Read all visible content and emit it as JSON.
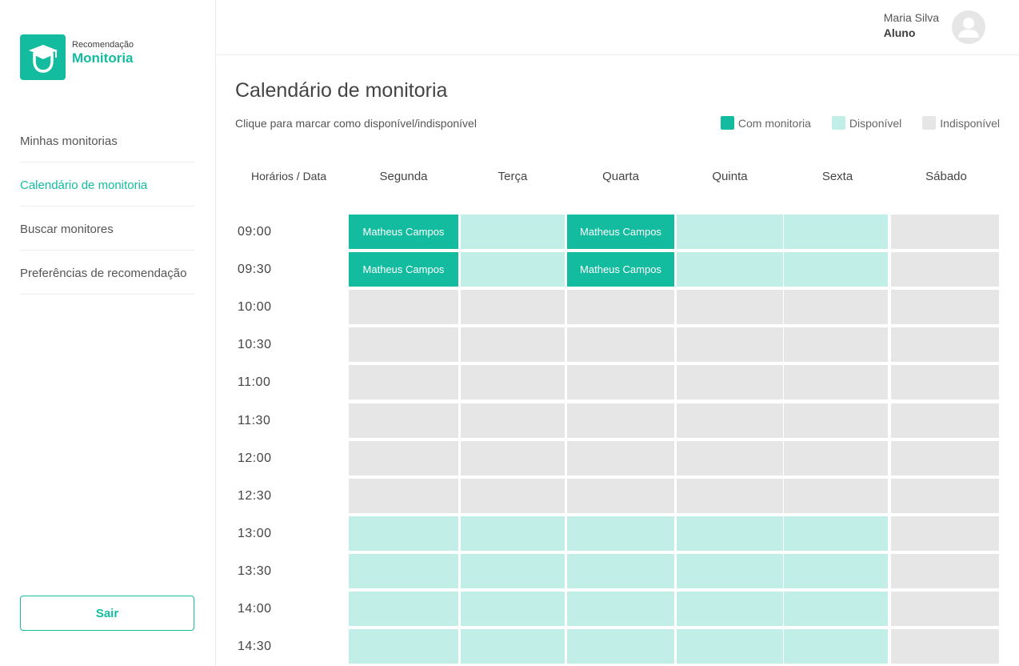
{
  "brand": {
    "subtitle": "Recomendação",
    "title": "Monitoria"
  },
  "nav": {
    "items": [
      {
        "label": "Minhas monitorias",
        "active": false
      },
      {
        "label": "Calendário de monitoria",
        "active": true
      },
      {
        "label": "Buscar monitores",
        "active": false
      },
      {
        "label": "Preferências de recomendação",
        "active": false
      }
    ],
    "logout_label": "Sair"
  },
  "user": {
    "name": "Maria Silva",
    "role": "Aluno",
    "avatar_icon": "user-avatar-icon"
  },
  "page": {
    "title": "Calendário de monitoria",
    "subtitle": "Clique para marcar como disponível/indisponível"
  },
  "legend": [
    {
      "label": "Com monitoria",
      "color": "#13bc9f"
    },
    {
      "label": "Disponível",
      "color": "#c2eee8"
    },
    {
      "label": "Indisponível",
      "color": "#e6e6e6"
    }
  ],
  "calendar": {
    "corner_header": "Horários / Data",
    "days": [
      "Segunda",
      "Terça",
      "Quarta",
      "Quinta",
      "Sexta",
      "Sábado"
    ],
    "rows": [
      {
        "time": "09:00",
        "cells": [
          {
            "status": "monitoria",
            "text": "Matheus Campos"
          },
          {
            "status": "disponivel",
            "text": ""
          },
          {
            "status": "monitoria",
            "text": "Matheus Campos"
          },
          {
            "status": "disponivel",
            "text": ""
          },
          {
            "status": "disponivel",
            "text": ""
          },
          {
            "status": "indisponivel",
            "text": ""
          }
        ]
      },
      {
        "time": "09:30",
        "cells": [
          {
            "status": "monitoria",
            "text": "Matheus Campos"
          },
          {
            "status": "disponivel",
            "text": ""
          },
          {
            "status": "monitoria",
            "text": "Matheus Campos"
          },
          {
            "status": "disponivel",
            "text": ""
          },
          {
            "status": "disponivel",
            "text": ""
          },
          {
            "status": "indisponivel",
            "text": ""
          }
        ]
      },
      {
        "time": "10:00",
        "cells": [
          {
            "status": "indisponivel",
            "text": ""
          },
          {
            "status": "indisponivel",
            "text": ""
          },
          {
            "status": "indisponivel",
            "text": ""
          },
          {
            "status": "indisponivel",
            "text": ""
          },
          {
            "status": "indisponivel",
            "text": ""
          },
          {
            "status": "indisponivel",
            "text": ""
          }
        ]
      },
      {
        "time": "10:30",
        "cells": [
          {
            "status": "indisponivel",
            "text": ""
          },
          {
            "status": "indisponivel",
            "text": ""
          },
          {
            "status": "indisponivel",
            "text": ""
          },
          {
            "status": "indisponivel",
            "text": ""
          },
          {
            "status": "indisponivel",
            "text": ""
          },
          {
            "status": "indisponivel",
            "text": ""
          }
        ]
      },
      {
        "time": "11:00",
        "cells": [
          {
            "status": "indisponivel",
            "text": ""
          },
          {
            "status": "indisponivel",
            "text": ""
          },
          {
            "status": "indisponivel",
            "text": ""
          },
          {
            "status": "indisponivel",
            "text": ""
          },
          {
            "status": "indisponivel",
            "text": ""
          },
          {
            "status": "indisponivel",
            "text": ""
          }
        ]
      },
      {
        "time": "11:30",
        "cells": [
          {
            "status": "indisponivel",
            "text": ""
          },
          {
            "status": "indisponivel",
            "text": ""
          },
          {
            "status": "indisponivel",
            "text": ""
          },
          {
            "status": "indisponivel",
            "text": ""
          },
          {
            "status": "indisponivel",
            "text": ""
          },
          {
            "status": "indisponivel",
            "text": ""
          }
        ]
      },
      {
        "time": "12:00",
        "cells": [
          {
            "status": "indisponivel",
            "text": ""
          },
          {
            "status": "indisponivel",
            "text": ""
          },
          {
            "status": "indisponivel",
            "text": ""
          },
          {
            "status": "indisponivel",
            "text": ""
          },
          {
            "status": "indisponivel",
            "text": ""
          },
          {
            "status": "indisponivel",
            "text": ""
          }
        ]
      },
      {
        "time": "12:30",
        "cells": [
          {
            "status": "indisponivel",
            "text": ""
          },
          {
            "status": "indisponivel",
            "text": ""
          },
          {
            "status": "indisponivel",
            "text": ""
          },
          {
            "status": "indisponivel",
            "text": ""
          },
          {
            "status": "indisponivel",
            "text": ""
          },
          {
            "status": "indisponivel",
            "text": ""
          }
        ]
      },
      {
        "time": "13:00",
        "cells": [
          {
            "status": "disponivel",
            "text": ""
          },
          {
            "status": "disponivel",
            "text": ""
          },
          {
            "status": "disponivel",
            "text": ""
          },
          {
            "status": "disponivel",
            "text": ""
          },
          {
            "status": "disponivel",
            "text": ""
          },
          {
            "status": "indisponivel",
            "text": ""
          }
        ]
      },
      {
        "time": "13:30",
        "cells": [
          {
            "status": "disponivel",
            "text": ""
          },
          {
            "status": "disponivel",
            "text": ""
          },
          {
            "status": "disponivel",
            "text": ""
          },
          {
            "status": "disponivel",
            "text": ""
          },
          {
            "status": "disponivel",
            "text": ""
          },
          {
            "status": "indisponivel",
            "text": ""
          }
        ]
      },
      {
        "time": "14:00",
        "cells": [
          {
            "status": "disponivel",
            "text": ""
          },
          {
            "status": "disponivel",
            "text": ""
          },
          {
            "status": "disponivel",
            "text": ""
          },
          {
            "status": "disponivel",
            "text": ""
          },
          {
            "status": "disponivel",
            "text": ""
          },
          {
            "status": "indisponivel",
            "text": ""
          }
        ]
      },
      {
        "time": "14:30",
        "cells": [
          {
            "status": "disponivel",
            "text": ""
          },
          {
            "status": "disponivel",
            "text": ""
          },
          {
            "status": "disponivel",
            "text": ""
          },
          {
            "status": "disponivel",
            "text": ""
          },
          {
            "status": "disponivel",
            "text": ""
          },
          {
            "status": "indisponivel",
            "text": ""
          }
        ]
      }
    ]
  },
  "colors": {
    "accent": "#13bc9f",
    "available": "#c2eee8",
    "unavailable": "#e6e6e6"
  }
}
